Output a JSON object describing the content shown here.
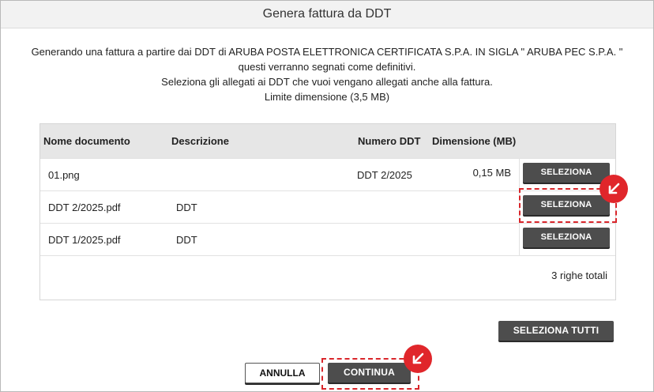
{
  "dialog": {
    "title": "Genera fattura da DDT",
    "intro": [
      "Generando una fattura a partire dai DDT di ARUBA POSTA ELETTRONICA CERTIFICATA S.P.A. IN SIGLA \" ARUBA PEC S.P.A. \"",
      "questi verranno segnati come definitivi.",
      "Seleziona gli allegati ai DDT che vuoi vengano allegati anche alla fattura.",
      "Limite dimensione (3,5 MB)"
    ]
  },
  "table": {
    "headers": {
      "name": "Nome documento",
      "description": "Descrizione",
      "number": "Numero DDT",
      "size": "Dimensione (MB)"
    },
    "rows": [
      {
        "name": "01.png",
        "description": "",
        "number": "DDT 2/2025",
        "size": "0,15 MB",
        "button": "SELEZIONA"
      },
      {
        "name": "DDT 2/2025.pdf",
        "description": "DDT",
        "number": "",
        "size": "",
        "button": "SELEZIONA"
      },
      {
        "name": "DDT 1/2025.pdf",
        "description": "DDT",
        "number": "",
        "size": "",
        "button": "SELEZIONA"
      }
    ],
    "total": "3 righe totali"
  },
  "actions": {
    "select_all": "SELEZIONA TUTTI",
    "cancel": "ANNULLA",
    "continue": "CONTINUA"
  },
  "colors": {
    "accent_red": "#e0262b",
    "button_dark": "#4d4d4d",
    "header_bg": "#e6e6e6"
  },
  "icons": {
    "highlight_badge": "arrow-down-left-icon"
  }
}
